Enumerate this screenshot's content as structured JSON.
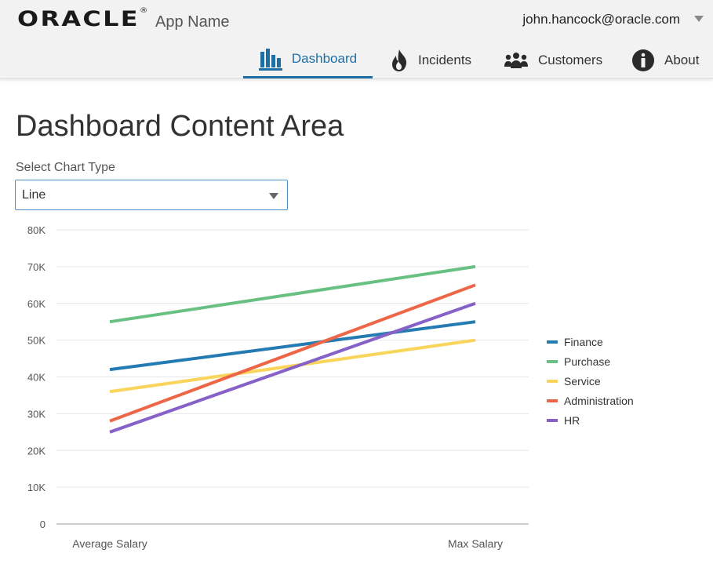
{
  "header": {
    "logo_text": "ORACLE",
    "logo_mark": "®",
    "app_name": "App Name",
    "user_email": "john.hancock@oracle.com"
  },
  "nav": [
    {
      "label": "Dashboard",
      "icon": "bar-chart-icon",
      "active": true
    },
    {
      "label": "Incidents",
      "icon": "fire-icon",
      "active": false
    },
    {
      "label": "Customers",
      "icon": "people-icon",
      "active": false
    },
    {
      "label": "About",
      "icon": "info-icon",
      "active": false
    }
  ],
  "main": {
    "title": "Dashboard Content Area",
    "select_label": "Select Chart Type",
    "select_value": "Line"
  },
  "colors": {
    "accent": "#1d6fa6"
  },
  "chart_data": {
    "type": "line",
    "categories": [
      "Average Salary",
      "Max Salary"
    ],
    "ylim": [
      0,
      80000
    ],
    "yticks": [
      "0",
      "10K",
      "20K",
      "30K",
      "40K",
      "50K",
      "60K",
      "70K",
      "80K"
    ],
    "grid": true,
    "legend_position": "right",
    "series": [
      {
        "name": "Finance",
        "values": [
          42000,
          55000
        ],
        "color": "#237bb1"
      },
      {
        "name": "Purchase",
        "values": [
          55000,
          70000
        ],
        "color": "#68c182"
      },
      {
        "name": "Service",
        "values": [
          36000,
          50000
        ],
        "color": "#fad55c"
      },
      {
        "name": "Administration",
        "values": [
          28000,
          65000
        ],
        "color": "#ed6647"
      },
      {
        "name": "HR",
        "values": [
          25000,
          60000
        ],
        "color": "#8561c8"
      }
    ]
  }
}
